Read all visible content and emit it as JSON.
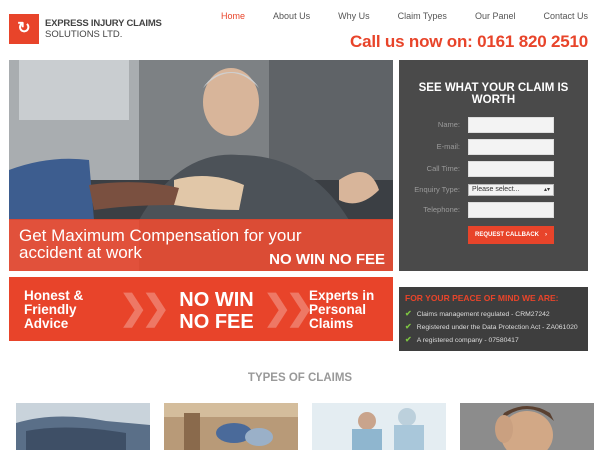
{
  "brand": {
    "line1": "EXPRESS INJURY CLAIMS",
    "line2": "SOLUTIONS LTD.",
    "accent": "#e8442a"
  },
  "nav": {
    "items": [
      "Home",
      "About Us",
      "Why Us",
      "Claim Types",
      "Our Panel",
      "Contact Us"
    ],
    "active": "Home"
  },
  "callus": "Call us now on: 0161 820 2510",
  "hero": {
    "title": "Get Maximum Compensation for your accident at work",
    "tagline": "NO WIN NO FEE"
  },
  "form": {
    "title": "SEE WHAT YOUR CLAIM IS WORTH",
    "fields": {
      "name": "Name:",
      "email": "E-mail:",
      "calltime": "Call Time:",
      "enquiry": "Enquiry Type:",
      "telephone": "Telephone:"
    },
    "select_value": "Please select...",
    "button": "REQUEST CALLBACK"
  },
  "promo": {
    "left_line1": "Honest &",
    "left_line2": "Friendly",
    "left_line3": "Advice",
    "mid_line1": "NO WIN",
    "mid_line2": "NO FEE",
    "right_line1": "Experts in",
    "right_line2": "Personal",
    "right_line3": "Claims"
  },
  "peace": {
    "title": "FOR YOUR PEACE OF MIND WE ARE:",
    "items": [
      "Claims management regulated - CRM27242",
      "Registered under the Data Protection Act - ZA061020",
      "A registered company - 07580417"
    ]
  },
  "types": {
    "title": "TYPES OF CLAIMS"
  }
}
